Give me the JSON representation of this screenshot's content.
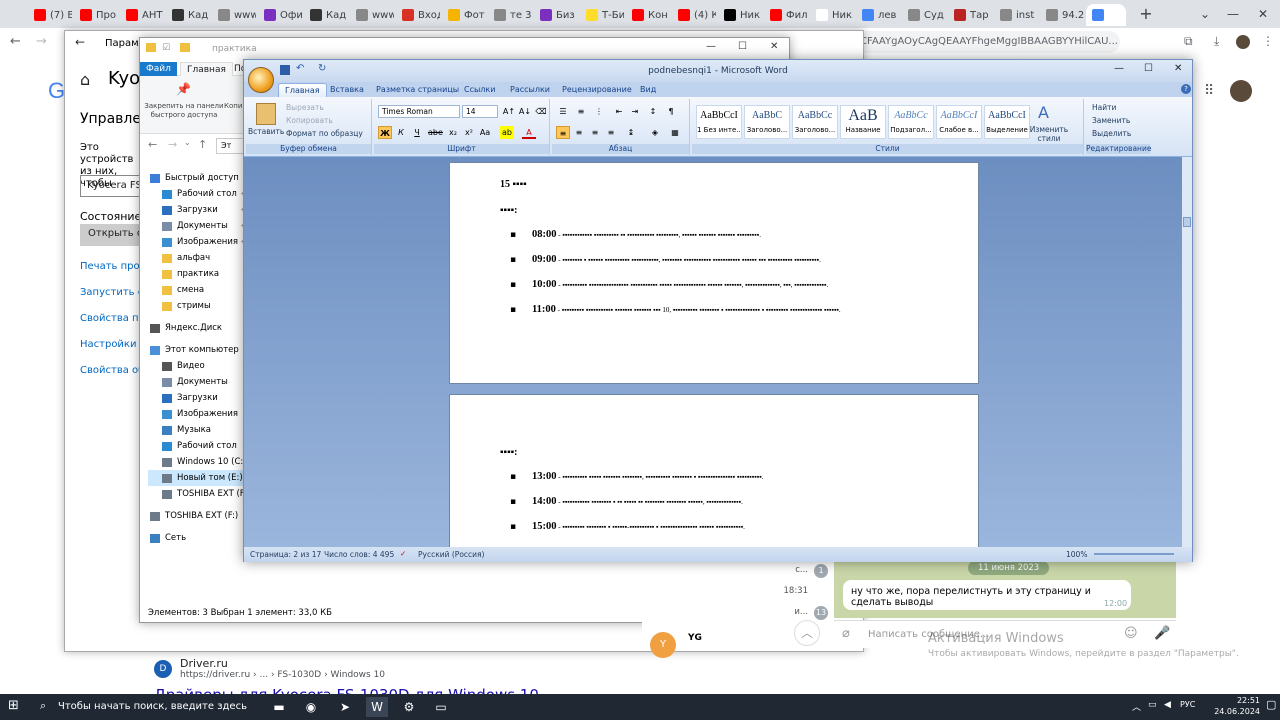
{
  "chrome": {
    "tabs": [
      {
        "label": "(7) В",
        "color": "#f00"
      },
      {
        "label": "Про",
        "color": "#f00"
      },
      {
        "label": "АНТ",
        "color": "#f00"
      },
      {
        "label": "Кад",
        "color": "#333"
      },
      {
        "label": "www",
        "color": "#888"
      },
      {
        "label": "Офи",
        "color": "#7b2fbe"
      },
      {
        "label": "Кад",
        "color": "#333"
      },
      {
        "label": "www",
        "color": "#888"
      },
      {
        "label": "Вход",
        "color": "#d93025"
      },
      {
        "label": "Фот",
        "color": "#f4b400"
      },
      {
        "label": "те 3",
        "color": "#888"
      },
      {
        "label": "Биз",
        "color": "#7b2fbe"
      },
      {
        "label": "Т-Би",
        "color": "#ffdd2d"
      },
      {
        "label": "Кон",
        "color": "#f00"
      },
      {
        "label": "(4) К",
        "color": "#f00"
      },
      {
        "label": "Ник",
        "color": "#000"
      },
      {
        "label": "Фил",
        "color": "#f00"
      },
      {
        "label": "Ник",
        "color": "#fff"
      },
      {
        "label": "лев",
        "color": "#4285f4"
      },
      {
        "label": "Суд",
        "color": "#888"
      },
      {
        "label": "Тар",
        "color": "#b22"
      },
      {
        "label": "inst",
        "color": "#888"
      },
      {
        "label": "94.2",
        "color": "#888"
      },
      {
        "label": "",
        "color": "#4285f4"
      }
    ],
    "new_tab": "+",
    "address_fragment": "CFAAYgAOyCAgQEAAYFhgeMggIBBAAGBYYHilCAU..."
  },
  "google": {
    "logo": "G",
    "driver_site": "Driver.ru",
    "driver_crumb": "https://driver.ru › ... › FS-1030D › Windows 10",
    "driver_title": "Драйверы для Kyocera FS-1030D для Windows 10"
  },
  "settings": {
    "title": "Параметр",
    "heading": "Kyoc",
    "manage": "Управлен",
    "desc": "Это устройств из них, чтобы",
    "device_box": "Kyocera FS-1",
    "state": "Состояние пр",
    "open_queue": "Открыть оч",
    "links": [
      "Печать проб",
      "Запустить сре",
      "Свойства при",
      "Настройки пе",
      "Свойства обо"
    ]
  },
  "explorer": {
    "title": "практика",
    "ribbon_tabs": [
      "Файл",
      "Главная",
      "По"
    ],
    "pin_label": "Закрепить на панели быстрого доступа",
    "copy_label": "Копи",
    "nav_path": "Эт",
    "tree": [
      {
        "label": "Быстрый доступ",
        "icon": "#3b7dd8",
        "indent": 0
      },
      {
        "label": "Рабочий стол",
        "icon": "#2a8ad4",
        "indent": 1,
        "pin": true
      },
      {
        "label": "Загрузки",
        "icon": "#2a6fc0",
        "indent": 1,
        "pin": true
      },
      {
        "label": "Документы",
        "icon": "#7a8ca8",
        "indent": 1,
        "pin": true
      },
      {
        "label": "Изображения",
        "icon": "#3a90d0",
        "indent": 1,
        "pin": true
      },
      {
        "label": "альфач",
        "icon": "#f0c040",
        "indent": 1
      },
      {
        "label": "практика",
        "icon": "#f0c040",
        "indent": 1
      },
      {
        "label": "смена",
        "icon": "#f0c040",
        "indent": 1
      },
      {
        "label": "стримы",
        "icon": "#f0c040",
        "indent": 1
      },
      {
        "label": "Яндекс.Диск",
        "icon": "#555",
        "indent": 0
      },
      {
        "label": "Этот компьютер",
        "icon": "#4a90d9",
        "indent": 0
      },
      {
        "label": "Видео",
        "icon": "#555",
        "indent": 1
      },
      {
        "label": "Документы",
        "icon": "#7a8ca8",
        "indent": 1
      },
      {
        "label": "Загрузки",
        "icon": "#2a6fc0",
        "indent": 1
      },
      {
        "label": "Изображения",
        "icon": "#3a90d0",
        "indent": 1
      },
      {
        "label": "Музыка",
        "icon": "#3a80c0",
        "indent": 1
      },
      {
        "label": "Рабочий стол",
        "icon": "#2a8ad4",
        "indent": 1
      },
      {
        "label": "Windows 10 (C:)",
        "icon": "#6c7a8a",
        "indent": 1
      },
      {
        "label": "Новый том (E:)",
        "icon": "#6c7a8a",
        "indent": 1,
        "selected": true
      },
      {
        "label": "TOSHIBA EXT (F:)",
        "icon": "#6c7a8a",
        "indent": 1
      },
      {
        "label": "TOSHIBA EXT (F:)",
        "icon": "#6c7a8a",
        "indent": 0
      },
      {
        "label": "Сеть",
        "icon": "#3a80c0",
        "indent": 0
      }
    ],
    "status": "Элементов: 3     Выбран 1 элемент: 33,0 КБ"
  },
  "word": {
    "title": "podnebesnqi1 - Microsoft Word",
    "tabs": [
      "Главная",
      "Вставка",
      "Разметка страницы",
      "Ссылки",
      "Рассылки",
      "Рецензирование",
      "Вид"
    ],
    "clipboard": {
      "paste": "Вставить",
      "cut": "Вырезать",
      "copy": "Копировать",
      "painter": "Формат по образцу",
      "label": "Буфер обмена"
    },
    "font": {
      "name": "Times Roman",
      "size": "14",
      "label": "Шрифт"
    },
    "paragraph_label": "Абзац",
    "styles": [
      {
        "preview": "AaBbCcI",
        "label": "1 Без инте...",
        "selected": false
      },
      {
        "preview": "AaBbC",
        "label": "Заголово...",
        "selected": false
      },
      {
        "preview": "AaBbCc",
        "label": "Заголово...",
        "selected": false
      },
      {
        "preview": "AaB",
        "label": "Название",
        "selected": false
      },
      {
        "preview": "AaBbCc",
        "label": "Подзагол...",
        "selected": false
      },
      {
        "preview": "AaBbCcI",
        "label": "Слабое в...",
        "selected": false
      },
      {
        "preview": "AaBbCcI",
        "label": "Выделение",
        "selected": false
      }
    ],
    "change_styles": "Изменить стили",
    "styles_label": "Стили",
    "editing": {
      "find": "Найти",
      "replace": "Заменить",
      "select": "Выделить",
      "label": "Редактирование"
    },
    "page1": {
      "heading": "15 ▪▪▪▪",
      "subheading": "▪▪▪▪:",
      "items": [
        {
          "time": "08:00",
          "text": " - ▪▪▪▪▪▪▪▪▪▪▪▪ ▪▪▪▪▪▪▪▪▪▪ ▪▪ ▪▪▪▪▪▪▪▪▪▪▪ ▪▪▪▪▪▪▪▪▪, ▪▪▪▪▪▪ ▪▪▪▪▪▪▪ ▪▪▪▪▪▪▪ ▪▪▪▪▪▪▪▪▪."
        },
        {
          "time": "09:00",
          "text": " - ▪▪▪▪▪▪▪▪ ▪ ▪▪▪▪▪▪ ▪▪▪▪▪▪▪▪▪▪ ▪▪▪▪▪▪▪▪▪▪▪, ▪▪▪▪▪▪▪▪ ▪▪▪▪▪▪▪▪▪▪▪ ▪▪▪▪▪▪▪▪▪▪▪ ▪▪▪▪▪▪ ▪▪▪ ▪▪▪▪▪▪▪▪▪▪ ▪▪▪▪▪▪▪▪▪▪."
        },
        {
          "time": "10:00",
          "text": " - ▪▪▪▪▪▪▪▪▪▪ ▪▪▪▪▪▪▪▪▪▪▪▪▪▪▪▪ ▪▪▪▪▪▪▪▪▪▪▪ ▪▪▪▪▪ ▪▪▪▪▪▪▪▪▪▪▪▪▪ ▪▪▪▪▪▪ ▪▪▪▪▪▪▪, ▪▪▪▪▪▪▪▪▪▪▪▪▪▪, ▪▪▪, ▪▪▪▪▪▪▪▪▪▪▪▪▪."
        },
        {
          "time": "11:00",
          "text": " - ▪▪▪▪▪▪▪▪▪ ▪▪▪▪▪▪▪▪▪▪▪ ▪▪▪▪▪▪▪ ▪▪▪▪▪▪▪ ▪▪▪ 10, ▪▪▪▪▪▪▪▪▪▪ ▪▪▪▪▪▪▪▪ ▪ ▪▪▪▪▪▪▪▪▪▪▪▪▪▪ ▪ ▪▪▪▪▪▪▪▪▪ ▪▪▪▪▪▪▪▪▪▪▪▪▪ ▪▪▪▪▪▪."
        }
      ]
    },
    "page2": {
      "subheading": "▪▪▪▪:",
      "items": [
        {
          "time": "13:00",
          "text": " - ▪▪▪▪▪▪▪▪▪▪ ▪▪▪▪▪ ▪▪▪▪▪▪▪ ▪▪▪▪▪▪▪▪, ▪▪▪▪▪▪▪▪▪▪ ▪▪▪▪▪▪▪▪ ▪ ▪▪▪▪▪▪▪▪▪▪▪▪▪▪▪ ▪▪▪▪▪▪▪▪▪▪."
        },
        {
          "time": "14:00",
          "text": " - ▪▪▪▪▪▪▪▪▪▪▪ ▪▪▪▪▪▪▪▪ ▪ ▪▪ ▪▪▪▪▪ ▪▪ ▪▪▪▪▪▪▪▪ ▪▪▪▪▪▪▪▪ ▪▪▪▪▪▪, ▪▪▪▪▪▪▪▪▪▪▪▪▪▪."
        },
        {
          "time": "15:00",
          "text": " - ▪▪▪▪▪▪▪▪▪ ▪▪▪▪▪▪▪▪ ▪ ▪▪▪▪▪▪-▪▪▪▪▪▪▪▪▪▪ ▪ ▪▪▪▪▪▪▪▪▪▪▪▪▪▪▪ ▪▪▪▪▪▪ ▪▪▪▪▪▪▪▪▪▪▪."
        }
      ]
    },
    "status": {
      "page": "Страница: 2 из 17",
      "words": "Число слов: 4 495",
      "lang": "Русский (Россия)",
      "zoom": "100%"
    }
  },
  "chat": {
    "date": "11 июня 2023",
    "message": "ну что же, пора перелистнуть и эту страницу и сделать выводы",
    "message_time": "12:00",
    "input_placeholder": "Написать сообщение...",
    "list": [
      {
        "snippet": "с...",
        "badge": "1"
      },
      {
        "snippet": "18:31",
        "badge": ""
      },
      {
        "snippet": "и...",
        "badge": "13"
      }
    ],
    "contact_initial": "Y",
    "contact_name": "YG",
    "activate_title": "Активация Windows",
    "activate_sub": "Чтобы активировать Windows, перейдите в раздел \"Параметры\"."
  },
  "taskbar": {
    "search": "Чтобы начать поиск, введите здесь запрос",
    "lang": "РУС",
    "time": "22:51",
    "date": "24.06.2024"
  }
}
